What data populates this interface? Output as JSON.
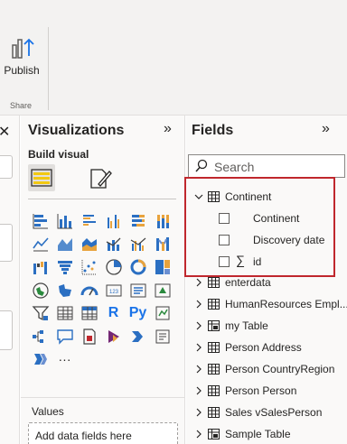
{
  "ribbon": {
    "publish_label": "Publish",
    "share_group_label": "Share"
  },
  "visualizations": {
    "title": "Visualizations",
    "collapse_glyph": "»",
    "build_visual_label": "Build visual",
    "r_label": "R",
    "py_label": "Py",
    "more_label": "···",
    "values_label": "Values",
    "add_fields_placeholder": "Add data fields here"
  },
  "fields": {
    "title": "Fields",
    "collapse_glyph": "»",
    "search_placeholder": "Search",
    "expanded_table": {
      "name": "Continent",
      "fields": [
        {
          "label": "Continent",
          "sigma": false
        },
        {
          "label": "Discovery date",
          "sigma": false
        },
        {
          "label": "id",
          "sigma": true
        }
      ]
    },
    "tables": [
      {
        "name": "enterdata",
        "icon": "table-icon"
      },
      {
        "name": "HumanResources Empl...",
        "icon": "table-icon"
      },
      {
        "name": "my Table",
        "icon": "calculated-table-icon"
      },
      {
        "name": "Person Address",
        "icon": "table-icon"
      },
      {
        "name": "Person CountryRegion",
        "icon": "table-icon"
      },
      {
        "name": "Person Person",
        "icon": "table-icon"
      },
      {
        "name": "Sales vSalesPerson",
        "icon": "table-icon"
      },
      {
        "name": "Sample Table",
        "icon": "calculated-table-icon"
      }
    ]
  },
  "colors": {
    "highlight": "#c0272d",
    "accent_blue": "#1a73e8",
    "pane_bg": "#faf9f8"
  }
}
